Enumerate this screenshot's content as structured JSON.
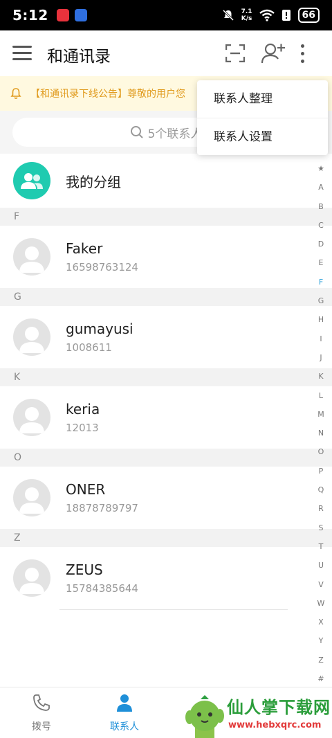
{
  "status_bar": {
    "time": "5:12",
    "net_speed_top": "7.1",
    "net_speed_unit": "K/s",
    "battery": "66"
  },
  "header": {
    "title": "和通讯录",
    "icons": [
      "menu-icon",
      "scan-icon",
      "add-contact-icon",
      "more-icon"
    ]
  },
  "notice": {
    "text": "【和通讯录下线公告】尊敬的用户您"
  },
  "search": {
    "placeholder": "5个联系人"
  },
  "dropdown": {
    "items": [
      "联系人整理",
      "联系人设置"
    ]
  },
  "group": {
    "label": "我的分组"
  },
  "sections": [
    {
      "letter": "F",
      "contacts": [
        {
          "name": "Faker",
          "number": "16598763124"
        }
      ]
    },
    {
      "letter": "G",
      "contacts": [
        {
          "name": "gumayusi",
          "number": "1008611"
        }
      ]
    },
    {
      "letter": "K",
      "contacts": [
        {
          "name": "keria",
          "number": "12013"
        }
      ]
    },
    {
      "letter": "O",
      "contacts": [
        {
          "name": "ONER",
          "number": "18878789797"
        }
      ]
    },
    {
      "letter": "Z",
      "contacts": [
        {
          "name": "ZEUS",
          "number": "15784385644"
        }
      ]
    }
  ],
  "alpha_index": [
    "★",
    "A",
    "B",
    "C",
    "D",
    "E",
    "F",
    "G",
    "H",
    "I",
    "J",
    "K",
    "L",
    "M",
    "N",
    "O",
    "P",
    "Q",
    "R",
    "S",
    "T",
    "U",
    "V",
    "W",
    "X",
    "Y",
    "Z",
    "#"
  ],
  "alpha_active": "F",
  "tabs": [
    {
      "label": "拨号",
      "icon": "phone-icon"
    },
    {
      "label": "联系人",
      "icon": "contacts-person-icon"
    }
  ],
  "watermark": {
    "text": "仙人掌下载网",
    "url": "www.hebxqrc.com"
  },
  "colors": {
    "accent": "#1e8fd8",
    "group_avatar": "#1fcbb0",
    "notice_text": "#e09a1c",
    "notice_bg": "#fff9e0"
  }
}
